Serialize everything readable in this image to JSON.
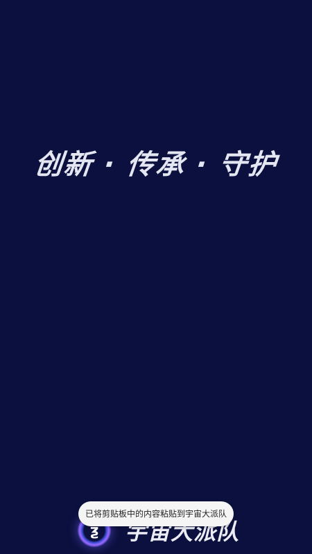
{
  "splash": {
    "slogan": "创新 · 传承 · 守护",
    "brand_name": "宇宙大派队",
    "logo_icon": "planet-ring-logo-icon",
    "background_color": "#0b103e"
  },
  "toast": {
    "message": "已将剪贴板中的内容粘贴到宇宙大派队"
  }
}
